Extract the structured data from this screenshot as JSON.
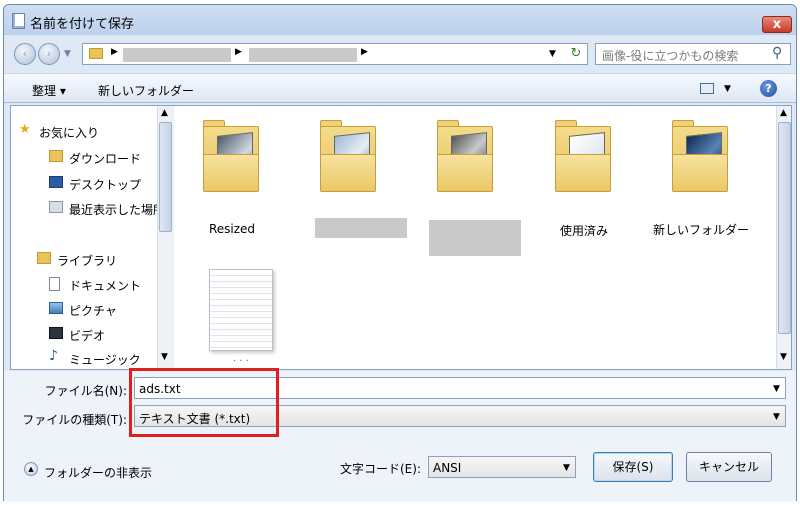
{
  "window": {
    "title": "名前を付けて保存",
    "close_label": "x"
  },
  "nav": {
    "back_label": "‹",
    "forward_label": "›",
    "search_placeholder": "画像-役に立つかもの検索"
  },
  "toolbar": {
    "organize_label": "整理 ▾",
    "new_folder_label": "新しいフォルダー"
  },
  "sidebar": {
    "items": [
      {
        "label": "お気に入り"
      },
      {
        "label": "ダウンロード"
      },
      {
        "label": "デスクトップ"
      },
      {
        "label": "最近表示した場所"
      },
      {
        "label": "ライブラリ"
      },
      {
        "label": "ドキュメント"
      },
      {
        "label": "ピクチャ"
      },
      {
        "label": "ビデオ"
      },
      {
        "label": "ミュージック"
      }
    ]
  },
  "files": [
    {
      "label": "Resized"
    },
    {
      "label": ""
    },
    {
      "label": ""
    },
    {
      "label": "使用済み"
    },
    {
      "label": "新しいフォルダー"
    }
  ],
  "form": {
    "filename_label": "ファイル名(N):",
    "filename_value": "ads.txt",
    "filetype_label": "ファイルの種類(T):",
    "filetype_value": "テキスト文書 (*.txt)",
    "encoding_label": "文字コード(E):",
    "encoding_value": "ANSI",
    "hide_folders_label": "フォルダーの非表示",
    "save_label": "保存(S)",
    "cancel_label": "キャンセル"
  }
}
